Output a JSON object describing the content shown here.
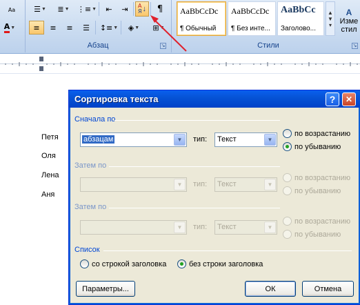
{
  "ribbon": {
    "group_paragraph": "Абзац",
    "group_styles": "Стили",
    "change_styles": "Изме",
    "change_styles_line2": "стил",
    "styles": [
      {
        "sample": "AaBbCcDc",
        "name": "¶ Обычный"
      },
      {
        "sample": "AaBbCcDc",
        "name": "¶ Без инте..."
      },
      {
        "sample": "AaBbCc",
        "name": "Заголово..."
      }
    ],
    "colors": {
      "accent_arrow": "#e0202c",
      "font_color_bar": "#e01818"
    }
  },
  "document": {
    "names": [
      "Петя",
      "Оля",
      "Лена",
      "Аня"
    ]
  },
  "dialog": {
    "title": "Сортировка текста",
    "help_glyph": "?",
    "close_glyph": "✕",
    "sort_by": {
      "label": "Сначала по",
      "field_value": "абзацам",
      "type_label": "тип:",
      "type_value": "Текст",
      "ascending": "по возрастанию",
      "descending": "по убыванию",
      "selected": "descending"
    },
    "then_by_1": {
      "label": "Затем по",
      "type_label": "тип:",
      "type_value": "Текст",
      "ascending": "по возрастанию",
      "descending": "по убыванию"
    },
    "then_by_2": {
      "label": "Затем по",
      "type_label": "тип:",
      "type_value": "Текст",
      "ascending": "по возрастанию",
      "descending": "по убыванию"
    },
    "list": {
      "label": "Список",
      "with_header": "со строкой заголовка",
      "without_header": "без строки заголовка",
      "selected": "without_header"
    },
    "buttons": {
      "options": "Параметры...",
      "ok": "ОК",
      "cancel": "Отмена"
    }
  }
}
